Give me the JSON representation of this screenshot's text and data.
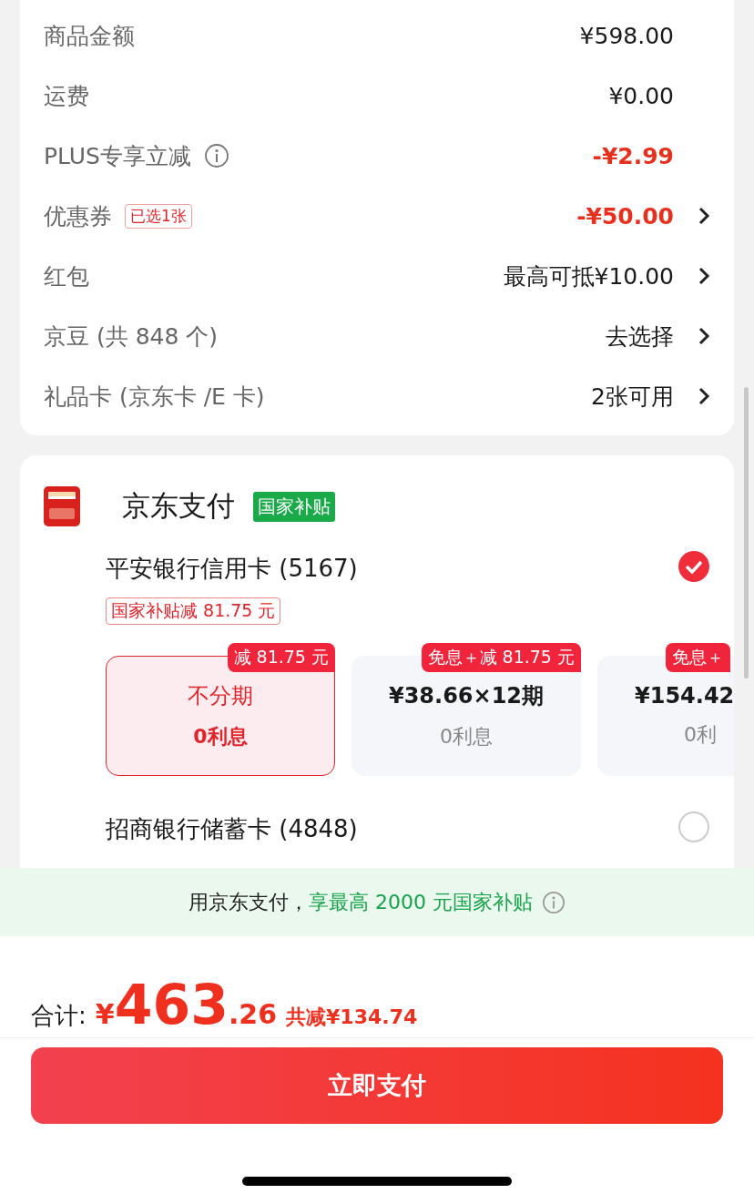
{
  "summary_rows": [
    {
      "label": "商品金额",
      "value": "¥598.00",
      "discount": false,
      "chevron": false
    },
    {
      "label": "运费",
      "value": "¥0.00",
      "discount": false,
      "chevron": false
    },
    {
      "label": "PLUS专享立减",
      "value": "-¥2.99",
      "discount": true,
      "chevron": false,
      "info": true
    },
    {
      "label": "优惠券",
      "badge": "已选1张",
      "value": "-¥50.00",
      "discount": true,
      "chevron": true
    },
    {
      "label": "红包",
      "value": "最高可抵¥10.00",
      "discount": false,
      "chevron": true
    },
    {
      "label": "京豆 (共 848 个)",
      "value": "去选择",
      "discount": false,
      "chevron": true
    },
    {
      "label": "礼品卡 (京东卡 /E 卡)",
      "value": "2张可用",
      "discount": false,
      "chevron": true
    }
  ],
  "payment": {
    "title": "京东支付",
    "badge": "国家补贴",
    "methods": [
      {
        "name": "平安银行信用卡 (5167)",
        "selected": true,
        "subsidy": "国家补贴减 81.75 元",
        "plans": [
          {
            "title": "不分期",
            "interest": "0利息",
            "tag": "减 81.75 元",
            "selected": true
          },
          {
            "title": "¥38.66×12期",
            "interest": "0利息",
            "tag": "免息＋减 81.75 元",
            "selected": false
          },
          {
            "title": "¥154.42",
            "interest": "0利",
            "tag": "免息＋",
            "selected": false
          }
        ]
      },
      {
        "name": "招商银行储蓄卡 (4848)",
        "selected": false
      }
    ]
  },
  "banner": {
    "text": "用京东支付，",
    "highlight": "享最高 2000 元国家补贴"
  },
  "total": {
    "label": "合计:",
    "currency": "¥",
    "integer": "463",
    "decimal": ".26",
    "saving": "共减¥134.74"
  },
  "pay_button": "立即支付"
}
